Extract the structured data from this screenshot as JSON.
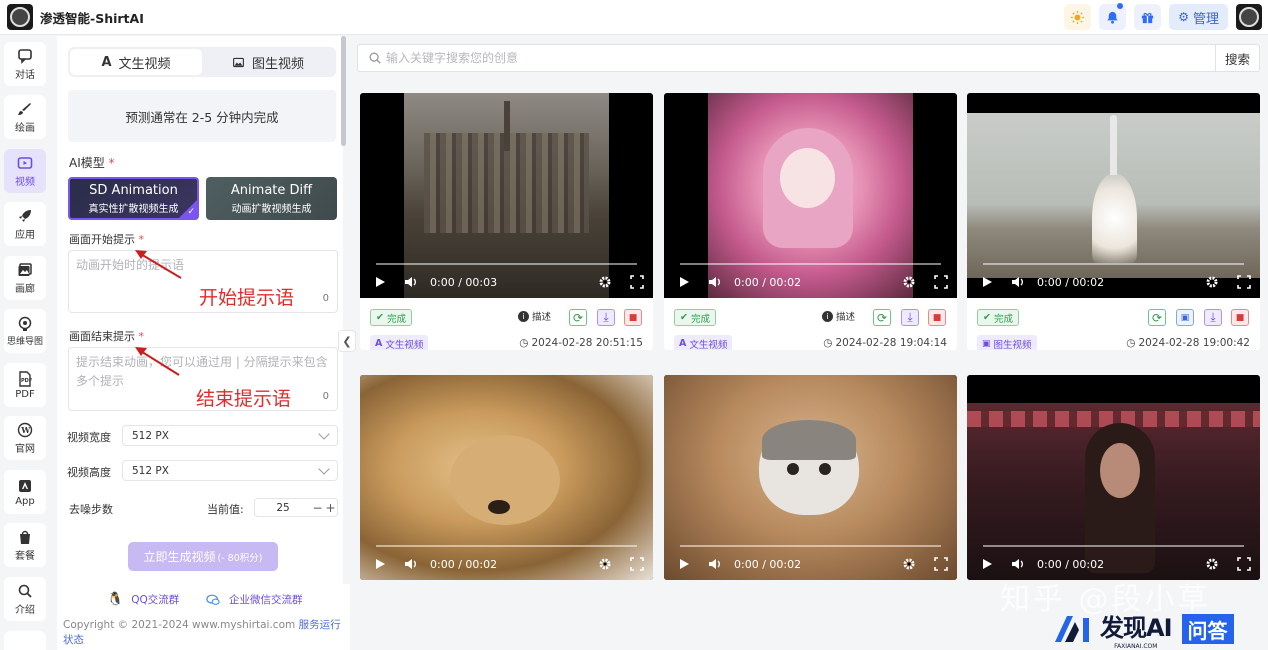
{
  "app": {
    "title": "渗透智能-ShirtAI"
  },
  "header": {
    "manage_label": "管理"
  },
  "sidebar": {
    "items": [
      {
        "label": "对话",
        "icon": "chat-icon"
      },
      {
        "label": "绘画",
        "icon": "brush-icon"
      },
      {
        "label": "视频",
        "icon": "video-icon",
        "active": true
      },
      {
        "label": "应用",
        "icon": "rocket-icon"
      },
      {
        "label": "画廊",
        "icon": "gallery-icon"
      },
      {
        "label": "思维导图",
        "icon": "mindmap-icon"
      },
      {
        "label": "PDF",
        "icon": "pdf-icon"
      },
      {
        "label": "官网",
        "icon": "wordpress-icon"
      },
      {
        "label": "App",
        "icon": "app-icon"
      },
      {
        "label": "套餐",
        "icon": "shopping-bag-icon"
      },
      {
        "label": "介绍",
        "icon": "search-icon"
      }
    ]
  },
  "panel": {
    "tabs": [
      {
        "label": "文生视频",
        "icon": "text-icon",
        "active": true
      },
      {
        "label": "图生视频",
        "icon": "image-icon"
      }
    ],
    "notice": "预测通常在 2-5 分钟内完成",
    "model_label": "AI模型",
    "models": [
      {
        "name": "SD Animation",
        "desc": "真实性扩散视频生成",
        "selected": true
      },
      {
        "name": "Animate Diff",
        "desc": "动画扩散视频生成"
      }
    ],
    "start_prompt": {
      "label": "画面开始提示",
      "placeholder": "动画开始时的提示语",
      "count": "0",
      "annotation": "开始提示语"
    },
    "end_prompt": {
      "label": "画面结束提示",
      "placeholder": "提示结束动画，您可以通过用 | 分隔提示来包含多个提示",
      "count": "0",
      "annotation": "结束提示语"
    },
    "width": {
      "label": "视频宽度",
      "value": "512 PX"
    },
    "height": {
      "label": "视频高度",
      "value": "512 PX"
    },
    "steps": {
      "label": "去噪步数",
      "current_label": "当前值:",
      "value": "25",
      "minus": "−",
      "plus": "+"
    },
    "generate": {
      "label": "立即生成视频",
      "cost": "(- 80积分)"
    }
  },
  "footer": {
    "qq": "QQ交流群",
    "wechat": "企业微信交流群",
    "copyright": "Copyright © 2021-2024 www.myshirtai.com",
    "status_link": "服务运行状态"
  },
  "search": {
    "placeholder": "输入关键字搜索您的创意",
    "button": "搜索"
  },
  "cards": [
    {
      "time_code": "0:00 / 00:03",
      "status": "完成",
      "describe": "描述",
      "type": "文生视频",
      "date": "2024-02-28 20:51:15"
    },
    {
      "time_code": "0:00 / 00:02",
      "status": "完成",
      "describe": "描述",
      "type": "文生视频",
      "date": "2024-02-28 19:04:14"
    },
    {
      "time_code": "0:00 / 00:02",
      "status": "完成",
      "type": "图生视频",
      "date": "2024-02-28 19:00:42"
    },
    {
      "time_code": "0:00 / 00:02"
    },
    {
      "time_code": "0:00 / 00:02"
    },
    {
      "time_code": "0:00 / 00:02"
    }
  ],
  "overlay": {
    "watermark": "知乎 @段小草",
    "brand": "发现AI",
    "brand_sub": "FAXIANAI.COM",
    "qa": "问答"
  },
  "colors": {
    "accent": "#6d4ee0",
    "annotation": "#e02b2b",
    "success": "#2b9a4b"
  }
}
